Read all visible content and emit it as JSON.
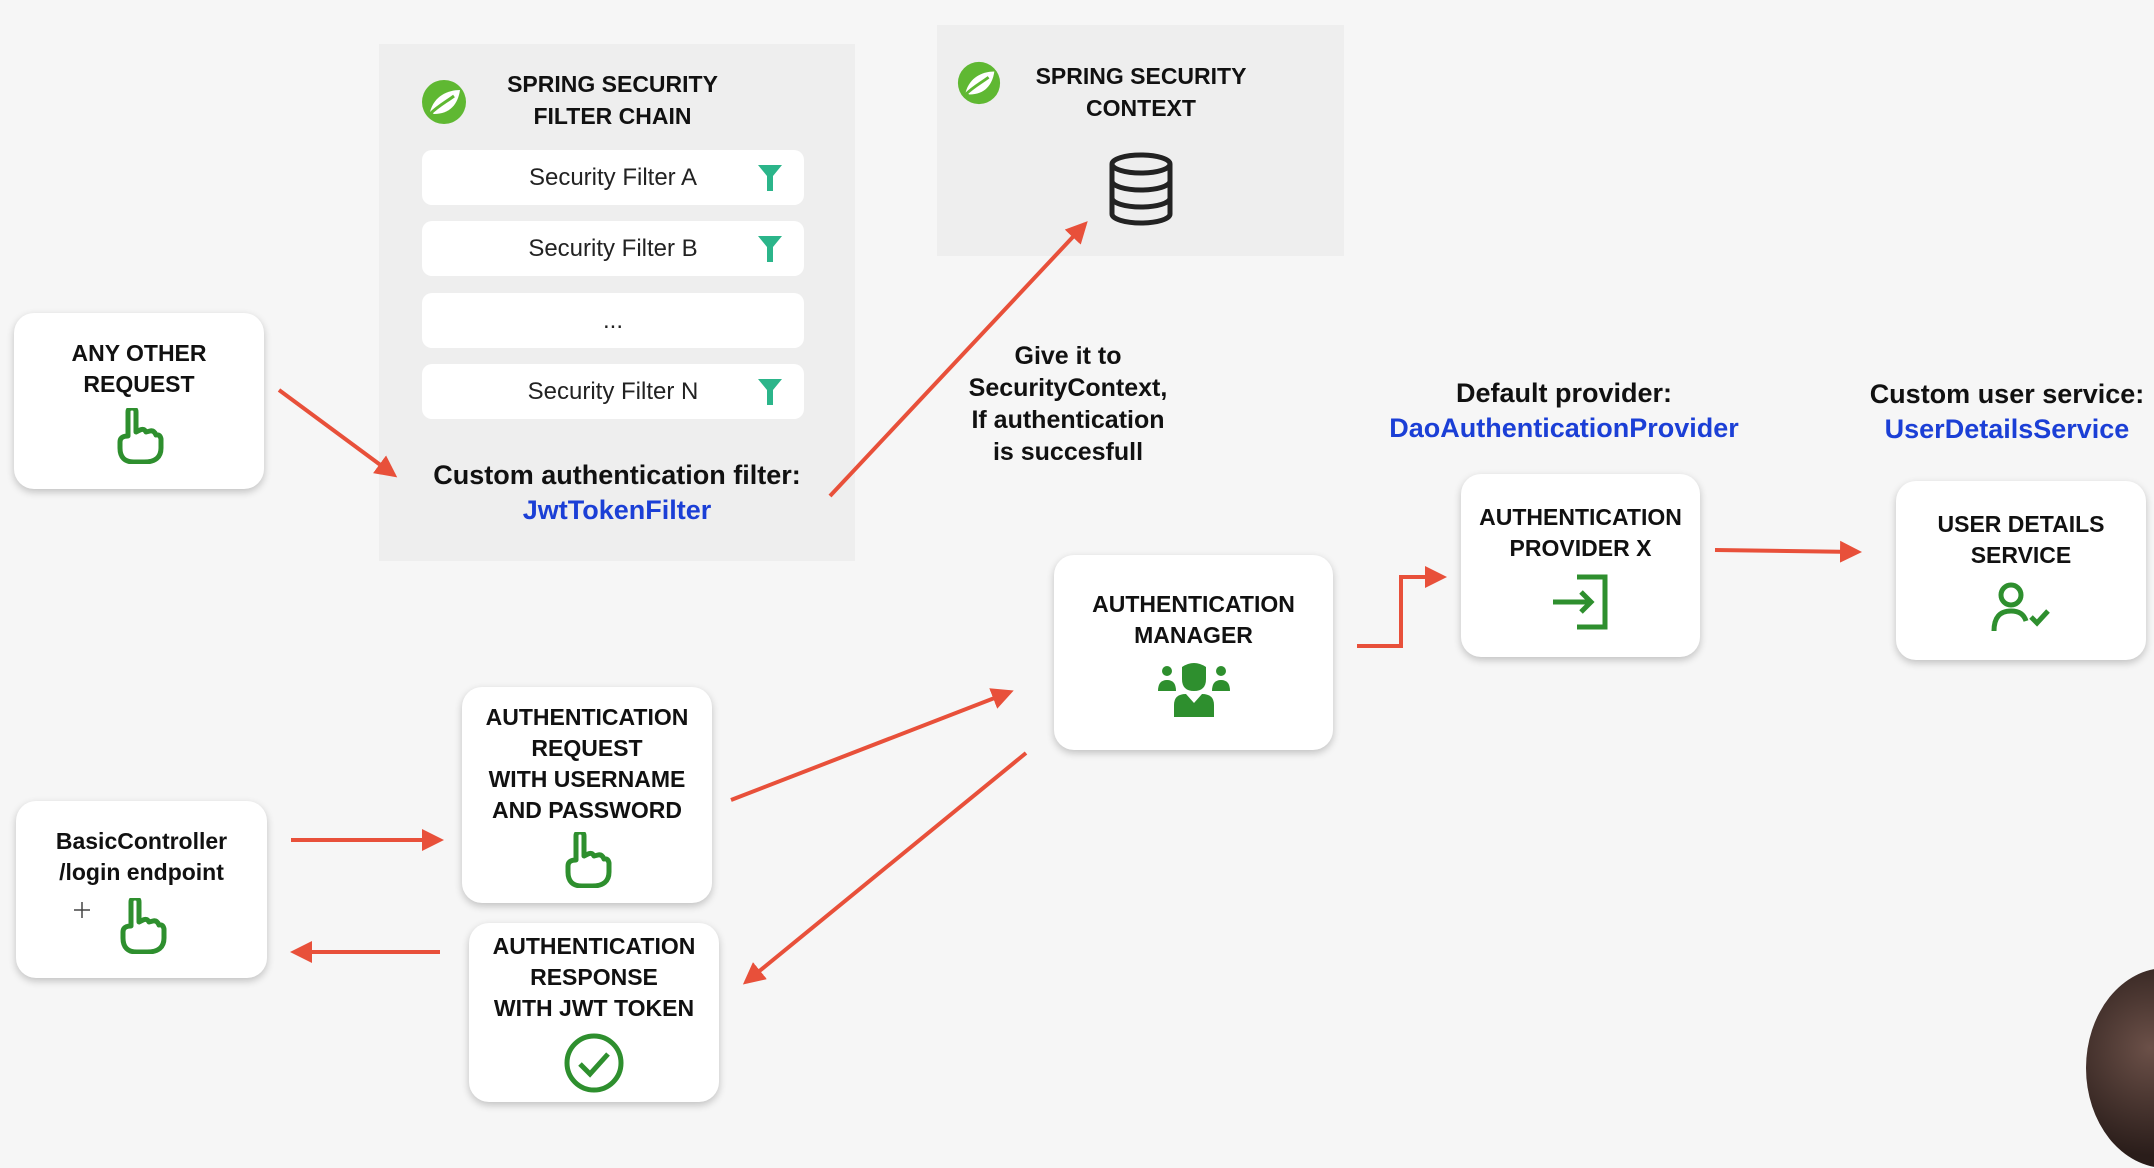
{
  "filter_chain": {
    "title": "SPRING SECURITY\nFILTER CHAIN",
    "filters": [
      "Security Filter A",
      "Security Filter B",
      "...",
      "Security Filter N"
    ],
    "custom_label": "Custom authentication filter:",
    "custom_class": "JwtTokenFilter"
  },
  "security_context": {
    "title": "SPRING SECURITY\nCONTEXT"
  },
  "give_note": "Give it to\nSecurityContext,\nIf authentication\nis succesfull",
  "default_provider": {
    "label": "Default provider:",
    "class": "DaoAuthenticationProvider"
  },
  "custom_user_service": {
    "label": "Custom user service:",
    "class": "UserDetailsService"
  },
  "boxes": {
    "any_other_request": "ANY OTHER\nREQUEST",
    "auth_manager": "AUTHENTICATION\nMANAGER",
    "auth_provider": "AUTHENTICATION\nPROVIDER X",
    "user_details": "USER DETAILS\nSERVICE",
    "auth_request": "AUTHENTICATION\nREQUEST\nWITH USERNAME\nAND PASSWORD",
    "basic_controller": "BasicController\n/login endpoint",
    "auth_response": "AUTHENTICATION\nRESPONSE\nWITH JWT TOKEN"
  },
  "colors": {
    "arrow": "#e8503a",
    "icon_green": "#2e8f2e",
    "link": "#1b3fd6",
    "funnel": "#2bb58a"
  }
}
